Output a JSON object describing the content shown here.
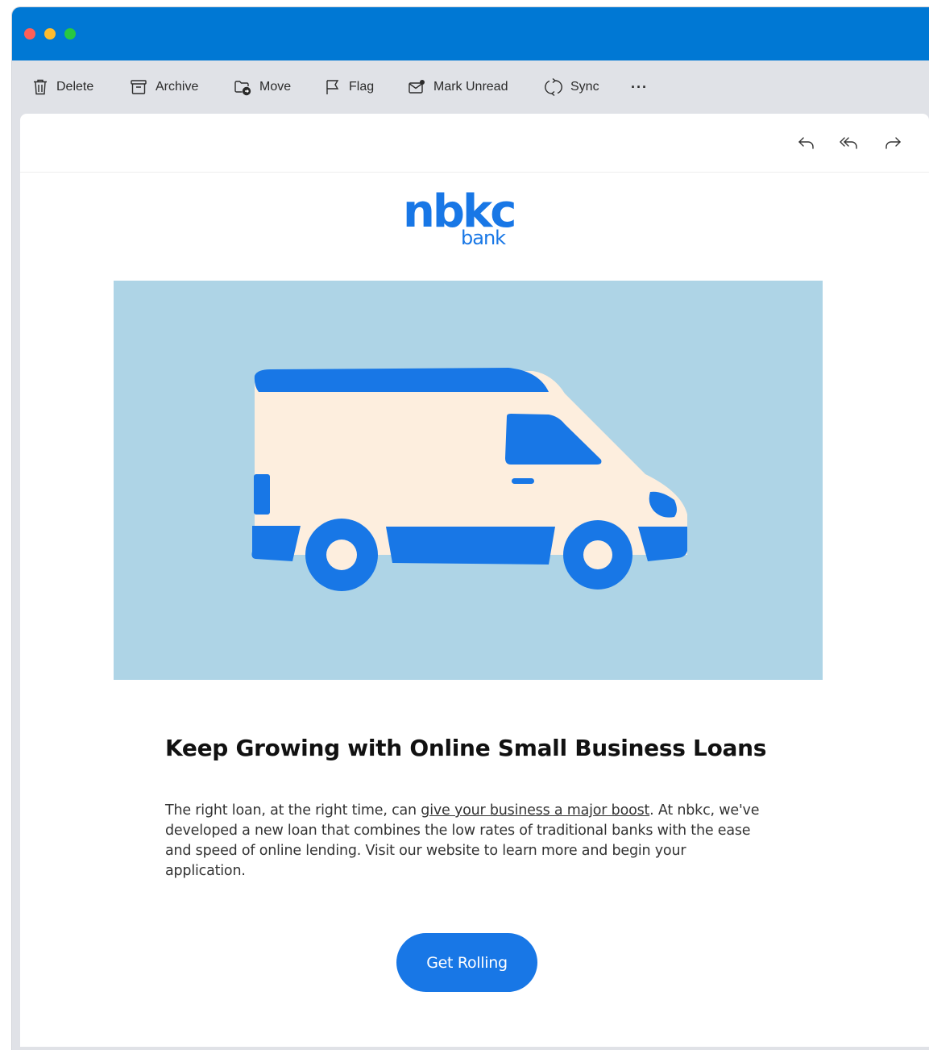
{
  "window": {
    "traffic_lights": [
      {
        "name": "close",
        "color": "#ff5f57"
      },
      {
        "name": "minimize",
        "color": "#febc2e"
      },
      {
        "name": "zoom",
        "color": "#28c840"
      }
    ],
    "titlebar_color": "#0078d4"
  },
  "toolbar": {
    "delete_label": "Delete",
    "archive_label": "Archive",
    "move_label": "Move",
    "flag_label": "Flag",
    "mark_unread_label": "Mark Unread",
    "sync_label": "Sync",
    "more_label": "···",
    "icons": [
      "trash-icon",
      "archive-icon",
      "move-folder-icon",
      "flag-icon",
      "mark-unread-icon",
      "sync-icon",
      "more-icon"
    ]
  },
  "reply_actions": {
    "icons": [
      "reply-icon",
      "reply-all-icon",
      "forward-icon"
    ]
  },
  "email": {
    "logo": {
      "main": "nbkc",
      "sub": "bank",
      "color": "#1877e6"
    },
    "hero": {
      "background": "#aed4e6",
      "illustration": "delivery-van"
    },
    "headline": "Keep Growing with Online Small Business Loans",
    "body": {
      "before_link": "The right loan, at the right time, can ",
      "link_text": "give your business a major boost",
      "after_link": ". At nbkc, we've developed a new loan that combines the low rates of traditional banks with the ease and speed of online lending. Visit our website to learn more and begin your application."
    },
    "cta_label": "Get Rolling",
    "accent_color": "#1877e6"
  }
}
